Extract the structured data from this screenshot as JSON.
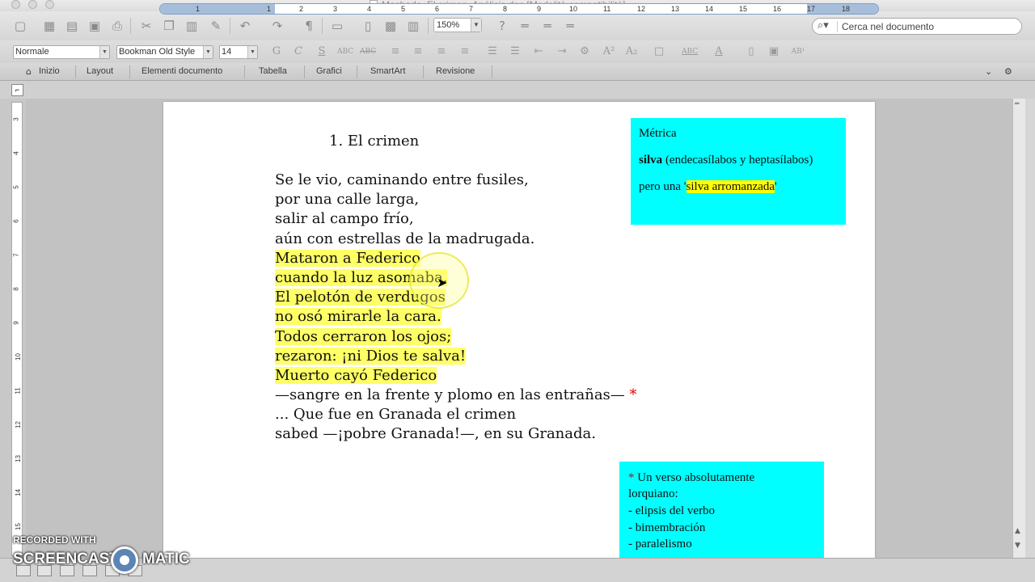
{
  "window": {
    "title": "Machado. El crimen. Análisis.doc [Modalità compatibilità]"
  },
  "toolbar": {
    "zoom": "150%",
    "search_placeholder": "Cerca nel documento"
  },
  "format_bar": {
    "style": "Normale",
    "font": "Bookman Old Style",
    "size": "14"
  },
  "ribbon": {
    "tabs": [
      "Inizio",
      "Layout",
      "Elementi documento",
      "Tabella",
      "Grafici",
      "SmartArt",
      "Revisione"
    ]
  },
  "ruler": {
    "h_numbers": [
      "1",
      "1",
      "2",
      "3",
      "4",
      "5",
      "6",
      "7",
      "8",
      "9",
      "10",
      "11",
      "12",
      "13",
      "14",
      "15",
      "16",
      "17",
      "18"
    ],
    "v_numbers": [
      "3",
      "4",
      "5",
      "6",
      "7",
      "8",
      "9",
      "10",
      "11",
      "12",
      "13",
      "14",
      "15"
    ]
  },
  "document": {
    "heading": "1. El crimen",
    "verse": [
      "Se le vio, caminando entre fusiles,",
      "por una calle larga,",
      "salir al campo frío,",
      "aún con estrellas de la madrugada.",
      "Mataron a Federico",
      "cuando la luz asomaba.",
      "El pelotón de verdugos",
      "no osó mirarle la cara.",
      "Todos cerraron los ojos;",
      "rezaron: ¡ni Dios te salva!",
      "Muerto cayó Federico",
      "—sangre en la frente y plomo en las entrañas—",
      "... Que fue en Granada el crimen",
      "sabed —¡pobre Granada!—, en su Granada."
    ],
    "star": "*",
    "note_box": {
      "title": "Métrica",
      "line2_bold": "silva",
      "line2_rest": " (endecasílabos y heptasílabos)",
      "line3_pre": "pero una '",
      "line3_hl": "silva arromanzada",
      "line3_post": "'"
    },
    "comment_box": {
      "star": "*",
      "line1": " Un verso absolutamente",
      "line2": "lorquiano:",
      "items": [
        "- elipsis del verbo",
        "- bimembración",
        "- paralelismo"
      ]
    }
  },
  "watermark": {
    "line1": "RECORDED WITH",
    "line2a": "SCREENCAST",
    "line2b": "MATIC"
  }
}
